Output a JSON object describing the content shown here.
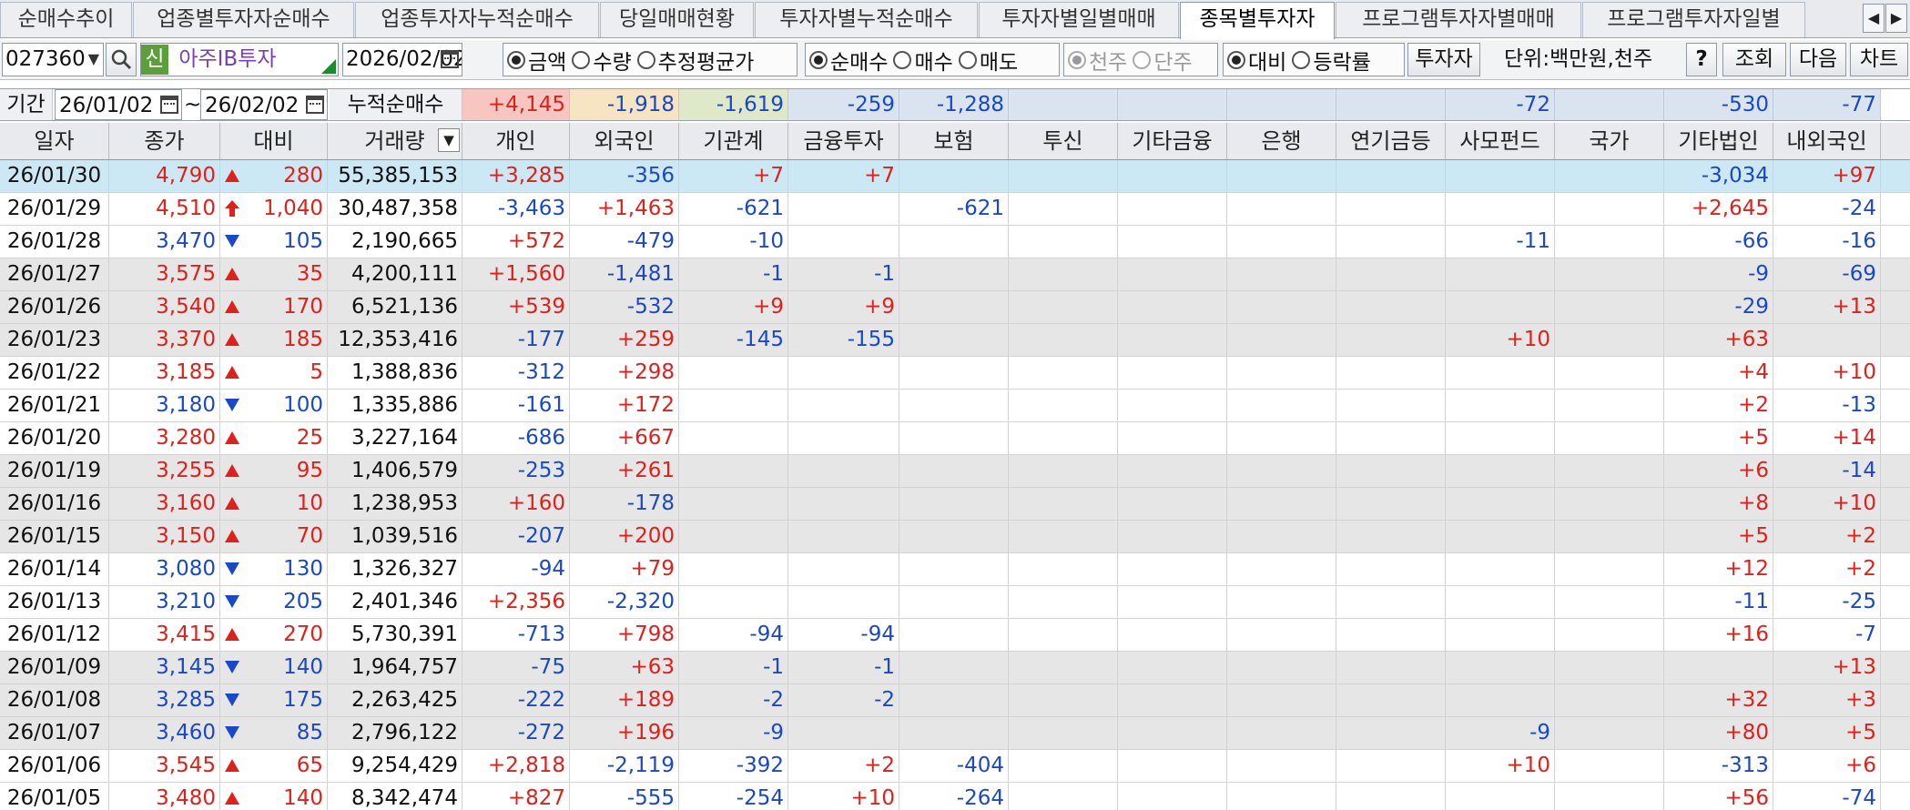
{
  "tabs": [
    {
      "label": "순매수추이",
      "active": false
    },
    {
      "label": "업종별투자자순매수",
      "active": false
    },
    {
      "label": "업종투자자누적순매수",
      "active": false
    },
    {
      "label": "당일매매현황",
      "active": false
    },
    {
      "label": "투자자별누적순매수",
      "active": false
    },
    {
      "label": "투자자별일별매매",
      "active": false
    },
    {
      "label": "종목별투자자",
      "active": true
    },
    {
      "label": "프로그램투자자별매매",
      "active": false
    },
    {
      "label": "프로그램투자자일별",
      "active": false
    }
  ],
  "tab_nav": {
    "prev": "◀",
    "next": "▶"
  },
  "toolbar": {
    "stock_code": "027360",
    "new_badge": "신",
    "stock_name": "아주IB투자",
    "date": "2026/02/02",
    "amount_type": {
      "options": [
        "금액",
        "수량",
        "추정평균가"
      ],
      "selected": 0
    },
    "trade_type": {
      "options": [
        "순매수",
        "매수",
        "매도"
      ],
      "selected": 0
    },
    "unit_type": {
      "options": [
        "천주",
        "단주"
      ],
      "selected": 0,
      "disabled": true
    },
    "compare_type": {
      "options": [
        "대비",
        "등락률"
      ],
      "selected": 0
    },
    "investor_button": "투자자",
    "unit_label": "단위:백만원,천주",
    "help_button": "?",
    "query_button": "조회",
    "next_button": "다음",
    "chart_button": "차트"
  },
  "period": {
    "label": "기간",
    "from": "26/01/02",
    "separator": "~",
    "to": "26/02/02",
    "cumulative_label": "누적순매수"
  },
  "summary": [
    "+4,145",
    "-1,918",
    "-1,619",
    "-259",
    "-1,288",
    "",
    "",
    "",
    "",
    "-72",
    "",
    "-530",
    "-77"
  ],
  "columns": [
    "일자",
    "종가",
    "대비",
    "거래량",
    "개인",
    "외국인",
    "기관계",
    "금융투자",
    "보험",
    "투신",
    "기타금융",
    "은행",
    "연기금등",
    "사모펀드",
    "국가",
    "기타법인",
    "내외국인"
  ],
  "colors": {
    "up": "#e0201a",
    "down": "#1a48c8",
    "selected_row": "#cde8f5",
    "shaded_row": "#e6e6e6",
    "personal_summary": "#f7c6c0",
    "foreign_summary": "#f7e4c2",
    "institution_summary": "#dfe8c8",
    "blue_summary": "#dae4f1"
  },
  "rows": [
    {
      "date": "26/01/30",
      "close": "4,790",
      "arrow": "up",
      "change": "280",
      "volume": "55,385,153",
      "vals": [
        "+3,285",
        "-356",
        "+7",
        "+7",
        "",
        "",
        "",
        "",
        "",
        "",
        "",
        "-3,034",
        "+97"
      ]
    },
    {
      "date": "26/01/29",
      "close": "4,510",
      "arrow": "limit-up",
      "change": "1,040",
      "volume": "30,487,358",
      "vals": [
        "-3,463",
        "+1,463",
        "-621",
        "",
        "-621",
        "",
        "",
        "",
        "",
        "",
        "",
        "+2,645",
        "-24"
      ]
    },
    {
      "date": "26/01/28",
      "close": "3,470",
      "arrow": "down",
      "change": "105",
      "volume": "2,190,665",
      "vals": [
        "+572",
        "-479",
        "-10",
        "",
        "",
        "",
        "",
        "",
        "",
        "-11",
        "",
        "-66",
        "-16"
      ]
    },
    {
      "date": "26/01/27",
      "close": "3,575",
      "arrow": "up",
      "change": "35",
      "volume": "4,200,111",
      "vals": [
        "+1,560",
        "-1,481",
        "-1",
        "-1",
        "",
        "",
        "",
        "",
        "",
        "",
        "",
        "-9",
        "-69"
      ]
    },
    {
      "date": "26/01/26",
      "close": "3,540",
      "arrow": "up",
      "change": "170",
      "volume": "6,521,136",
      "vals": [
        "+539",
        "-532",
        "+9",
        "+9",
        "",
        "",
        "",
        "",
        "",
        "",
        "",
        "-29",
        "+13"
      ]
    },
    {
      "date": "26/01/23",
      "close": "3,370",
      "arrow": "up",
      "change": "185",
      "volume": "12,353,416",
      "vals": [
        "-177",
        "+259",
        "-145",
        "-155",
        "",
        "",
        "",
        "",
        "",
        "+10",
        "",
        "+63",
        ""
      ]
    },
    {
      "date": "26/01/22",
      "close": "3,185",
      "arrow": "up",
      "change": "5",
      "volume": "1,388,836",
      "vals": [
        "-312",
        "+298",
        "",
        "",
        "",
        "",
        "",
        "",
        "",
        "",
        "",
        "+4",
        "+10"
      ]
    },
    {
      "date": "26/01/21",
      "close": "3,180",
      "arrow": "down",
      "change": "100",
      "volume": "1,335,886",
      "vals": [
        "-161",
        "+172",
        "",
        "",
        "",
        "",
        "",
        "",
        "",
        "",
        "",
        "+2",
        "-13"
      ]
    },
    {
      "date": "26/01/20",
      "close": "3,280",
      "arrow": "up",
      "change": "25",
      "volume": "3,227,164",
      "vals": [
        "-686",
        "+667",
        "",
        "",
        "",
        "",
        "",
        "",
        "",
        "",
        "",
        "+5",
        "+14"
      ]
    },
    {
      "date": "26/01/19",
      "close": "3,255",
      "arrow": "up",
      "change": "95",
      "volume": "1,406,579",
      "vals": [
        "-253",
        "+261",
        "",
        "",
        "",
        "",
        "",
        "",
        "",
        "",
        "",
        "+6",
        "-14"
      ]
    },
    {
      "date": "26/01/16",
      "close": "3,160",
      "arrow": "up",
      "change": "10",
      "volume": "1,238,953",
      "vals": [
        "+160",
        "-178",
        "",
        "",
        "",
        "",
        "",
        "",
        "",
        "",
        "",
        "+8",
        "+10"
      ]
    },
    {
      "date": "26/01/15",
      "close": "3,150",
      "arrow": "up",
      "change": "70",
      "volume": "1,039,516",
      "vals": [
        "-207",
        "+200",
        "",
        "",
        "",
        "",
        "",
        "",
        "",
        "",
        "",
        "+5",
        "+2"
      ]
    },
    {
      "date": "26/01/14",
      "close": "3,080",
      "arrow": "down",
      "change": "130",
      "volume": "1,326,327",
      "vals": [
        "-94",
        "+79",
        "",
        "",
        "",
        "",
        "",
        "",
        "",
        "",
        "",
        "+12",
        "+2"
      ]
    },
    {
      "date": "26/01/13",
      "close": "3,210",
      "arrow": "down",
      "change": "205",
      "volume": "2,401,346",
      "vals": [
        "+2,356",
        "-2,320",
        "",
        "",
        "",
        "",
        "",
        "",
        "",
        "",
        "",
        "-11",
        "-25"
      ]
    },
    {
      "date": "26/01/12",
      "close": "3,415",
      "arrow": "up",
      "change": "270",
      "volume": "5,730,391",
      "vals": [
        "-713",
        "+798",
        "-94",
        "-94",
        "",
        "",
        "",
        "",
        "",
        "",
        "",
        "+16",
        "-7"
      ]
    },
    {
      "date": "26/01/09",
      "close": "3,145",
      "arrow": "down",
      "change": "140",
      "volume": "1,964,757",
      "vals": [
        "-75",
        "+63",
        "-1",
        "-1",
        "",
        "",
        "",
        "",
        "",
        "",
        "",
        "",
        "+13"
      ]
    },
    {
      "date": "26/01/08",
      "close": "3,285",
      "arrow": "down",
      "change": "175",
      "volume": "2,263,425",
      "vals": [
        "-222",
        "+189",
        "-2",
        "-2",
        "",
        "",
        "",
        "",
        "",
        "",
        "",
        "+32",
        "+3"
      ]
    },
    {
      "date": "26/01/07",
      "close": "3,460",
      "arrow": "down",
      "change": "85",
      "volume": "2,796,122",
      "vals": [
        "-272",
        "+196",
        "-9",
        "",
        "",
        "",
        "",
        "",
        "",
        "-9",
        "",
        "+80",
        "+5"
      ]
    },
    {
      "date": "26/01/06",
      "close": "3,545",
      "arrow": "up",
      "change": "65",
      "volume": "9,254,429",
      "vals": [
        "+2,818",
        "-2,119",
        "-392",
        "+2",
        "-404",
        "",
        "",
        "",
        "",
        "+10",
        "",
        "-313",
        "+6"
      ]
    },
    {
      "date": "26/01/05",
      "close": "3,480",
      "arrow": "up",
      "change": "140",
      "volume": "8,342,474",
      "vals": [
        "+827",
        "-555",
        "-254",
        "+10",
        "-264",
        "",
        "",
        "",
        "",
        "",
        "",
        "+56",
        "-74"
      ]
    }
  ]
}
